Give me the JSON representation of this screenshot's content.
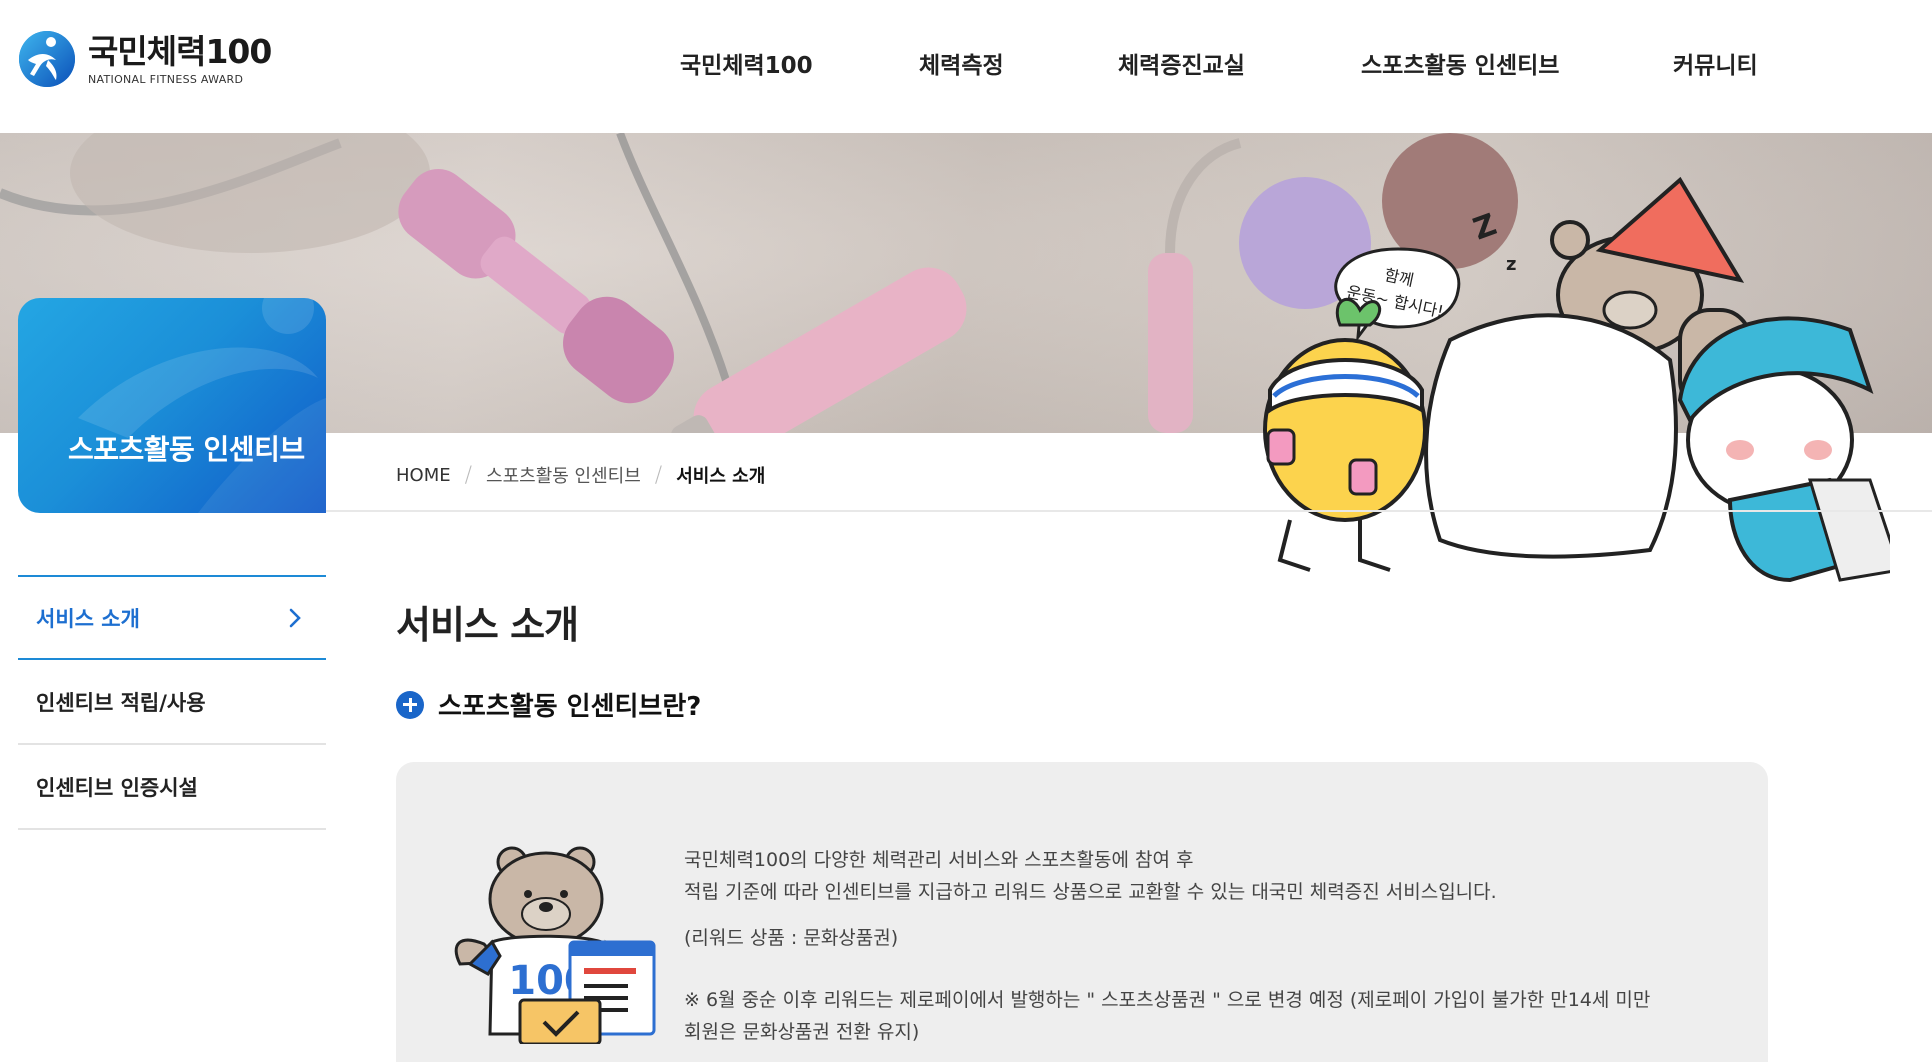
{
  "header": {
    "logo_title": "국민체력100",
    "logo_sub": "NATIONAL FITNESS AWARD",
    "nav": [
      "국민체력100",
      "체력측정",
      "체력증진교실",
      "스포츠활동 인센티브",
      "커뮤니티"
    ]
  },
  "banner": {
    "speech": [
      "함께",
      "운동~ 합시다!"
    ]
  },
  "side": {
    "title": "스포츠활동 인센티브"
  },
  "breadcrumb": [
    "HOME",
    "스포츠활동 인센티브",
    "서비스 소개"
  ],
  "lnb": {
    "items": [
      {
        "label": "서비스 소개",
        "active": true
      },
      {
        "label": "인센티브 적립/사용",
        "active": false
      },
      {
        "label": "인센티브 인증시설",
        "active": false
      }
    ]
  },
  "content": {
    "page_title": "서비스 소개",
    "section_title": "스포츠활동 인센티브란?",
    "lines": [
      "국민체력100의 다양한 체력관리 서비스와 스포츠활동에 참여 후",
      "적립 기준에 따라 인센티브를 지급하고 리워드 상품으로 교환할 수 있는 대국민 체력증진 서비스입니다.",
      "(리워드 상품 : 문화상품권)",
      "※ 6월 중순 이후 리워드는 제로페이에서 발행하는 \" 스포츠상품권 \" 으로 변경 예정 (제로페이 가입이 불가한 만14세 미만",
      "회원은 문화상품권 전환 유지)"
    ],
    "bear_shirt": "100"
  },
  "colors": {
    "brand_blue": "#1a66c9",
    "active_blue": "#1d6fd0",
    "box_gray": "#eeeeee"
  }
}
